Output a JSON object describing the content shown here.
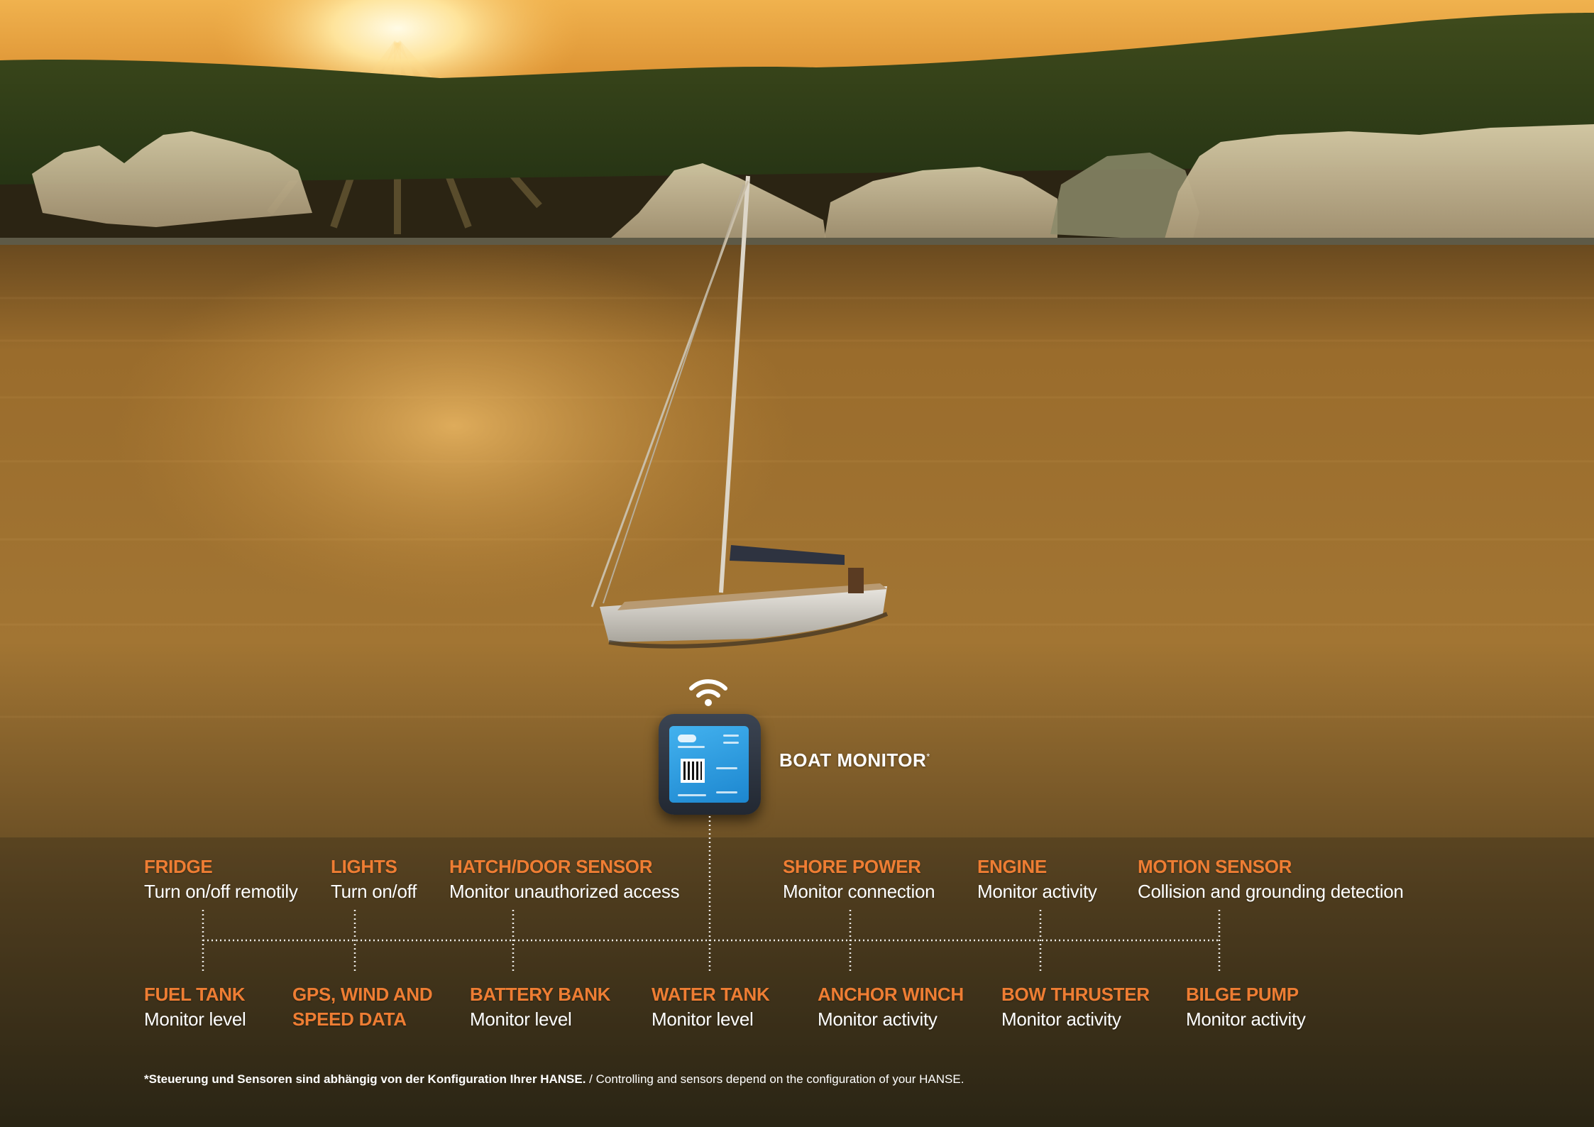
{
  "device": {
    "name": "BOAT MONITOR",
    "asterisk": "*"
  },
  "top_features": [
    {
      "heading": "FRIDGE",
      "text": "Turn on/off remotily"
    },
    {
      "heading": "LIGHTS",
      "text": "Turn on/off"
    },
    {
      "heading": "HATCH/DOOR SENSOR",
      "text": "Monitor unauthorized access"
    },
    {
      "heading": "SHORE POWER",
      "text": "Monitor connection"
    },
    {
      "heading": "ENGINE",
      "text": "Monitor activity"
    },
    {
      "heading": "MOTION SENSOR",
      "text": "Collision and grounding detection"
    }
  ],
  "bottom_features": [
    {
      "heading": "FUEL TANK",
      "text": "Monitor level"
    },
    {
      "heading_line1": "GPS, WIND AND",
      "heading_line2": "SPEED DATA"
    },
    {
      "heading": "BATTERY BANK",
      "text": "Monitor level"
    },
    {
      "heading": "WATER TANK",
      "text": "Monitor level"
    },
    {
      "heading": "ANCHOR WINCH",
      "text": "Monitor activity"
    },
    {
      "heading": "BOW THRUSTER",
      "text": "Monitor activity"
    },
    {
      "heading": "BILGE PUMP",
      "text": "Monitor activity"
    }
  ],
  "footnote": {
    "german": "*Steuerung und Sensoren sind abhängig von der Konfiguration Ihrer HANSE.",
    "english": " / Controlling and sensors depend on the configuration of your HANSE."
  },
  "colors": {
    "accent_orange": "#ee7d33",
    "text_white": "#ffffff",
    "device_screen_blue": "#2a9ae0"
  },
  "icons": [
    "wifi-icon",
    "qr-code-icon"
  ]
}
